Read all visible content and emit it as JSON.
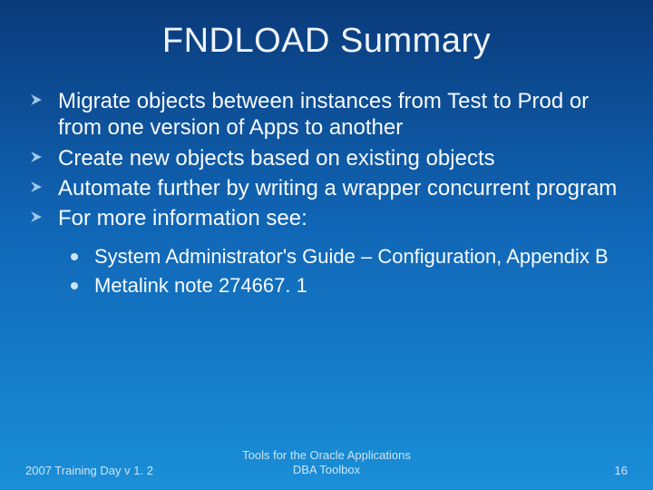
{
  "title": "FNDLOAD Summary",
  "bullets": {
    "b0": "Migrate objects between instances from Test to Prod or from one version of Apps to another",
    "b1": "Create new objects based on existing objects",
    "b2": "Automate further by writing a wrapper concurrent program",
    "b3": "For more information see:"
  },
  "subbullets": {
    "s0": "System Administrator's Guide – Configuration, Appendix B",
    "s1": "Metalink note 274667. 1"
  },
  "footer": {
    "left": "2007 Training Day v 1. 2",
    "center_line1": "Tools for the Oracle Applications",
    "center_line2": "DBA Toolbox",
    "right": "16"
  }
}
